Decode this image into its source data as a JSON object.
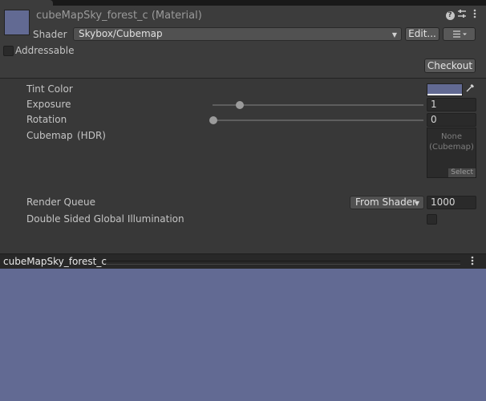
{
  "header": {
    "title": "cubeMapSky_forest_c (Material)",
    "shader_label": "Shader",
    "shader_value": "Skybox/Cubemap",
    "edit_label": "Edit...",
    "addressable_label": "Addressable",
    "checkout_label": "Checkout",
    "icons": [
      "help-icon",
      "preset-sliders-icon",
      "kebab-menu-icon",
      "list-menu-icon"
    ]
  },
  "properties": {
    "tint_color": {
      "label": "Tint Color",
      "color": "#626a93"
    },
    "exposure": {
      "label": "Exposure",
      "value": "1",
      "min": 0,
      "max": 8,
      "numeric": 1
    },
    "rotation": {
      "label": "Rotation",
      "value": "0",
      "min": 0,
      "max": 360,
      "numeric": 0
    },
    "cubemap": {
      "label": "Cubemap",
      "tag": "(HDR)",
      "none_text": "None",
      "type_text": "(Cubemap)",
      "select_label": "Select"
    },
    "render_queue": {
      "label": "Render Queue",
      "mode": "From Shader",
      "value": "1000"
    },
    "double_sided_gi": {
      "label": "Double Sided Global Illumination",
      "checked": false
    }
  },
  "preview": {
    "name": "cubeMapSky_forest_c",
    "color": "#626a93"
  }
}
